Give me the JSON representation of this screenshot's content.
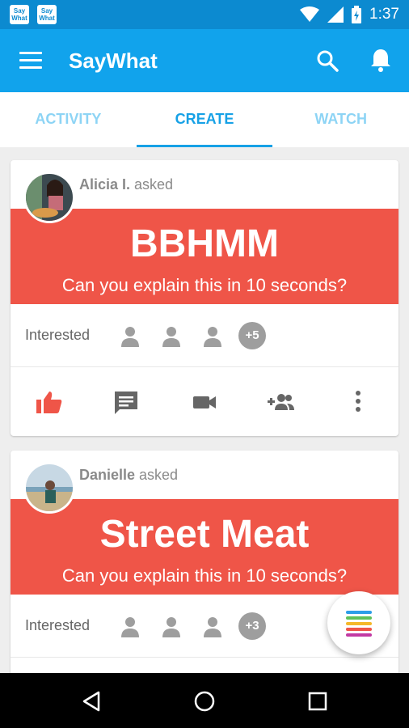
{
  "status_bar": {
    "notification_icons": [
      "Say What",
      "Say What"
    ],
    "time": "1:37",
    "icons": [
      "wifi-icon",
      "signal-icon",
      "battery-icon"
    ]
  },
  "app_bar": {
    "title": "SayWhat",
    "icons": [
      "menu-icon",
      "search-icon",
      "bell-icon"
    ]
  },
  "tabs": [
    {
      "label": "ACTIVITY",
      "active": false
    },
    {
      "label": "CREATE",
      "active": true
    },
    {
      "label": "WATCH",
      "active": false
    }
  ],
  "cards": [
    {
      "asker_name": "Alicia I.",
      "asker_suffix": " asked",
      "title": "BBHMM",
      "subtitle": "Can you explain this in 10 seconds?",
      "interested_label": "Interested",
      "extra_count": "+5",
      "actions": [
        "thumbs-up-icon",
        "comment-icon",
        "video-icon",
        "add-friend-icon",
        "more-vert-icon"
      ]
    },
    {
      "asker_name": "Danielle",
      "asker_suffix": " asked",
      "title": "Street Meat",
      "subtitle": "Can you explain this in 10 seconds?",
      "interested_label": "Interested",
      "extra_count": "+3"
    }
  ],
  "colors": {
    "status_bar": "#0c8ad0",
    "app_bar": "#11a3ec",
    "banner": "#ef5548",
    "like_active": "#ef5548"
  },
  "nav": [
    "back-icon",
    "home-icon",
    "recents-icon"
  ]
}
